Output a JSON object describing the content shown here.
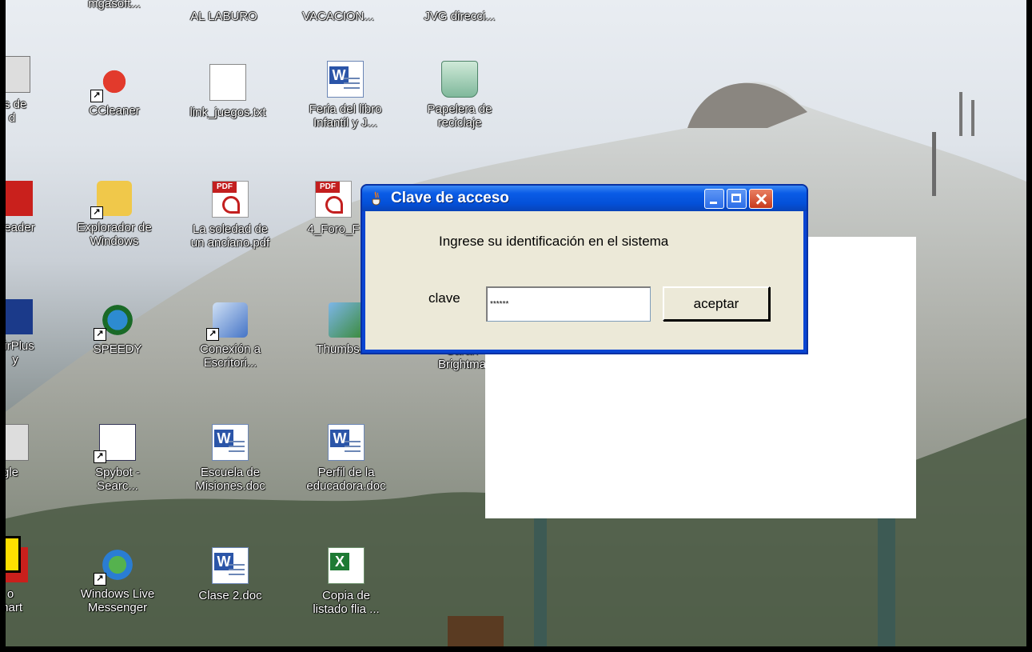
{
  "desktop": {
    "icons": [
      {
        "name": "icon-partial-top-1",
        "label": "mgasoft...",
        "type": "generic"
      },
      {
        "name": "icon-al-laburo",
        "label": "AL LABURO",
        "type": "generic"
      },
      {
        "name": "icon-vacacion",
        "label": "VACACION...",
        "type": "generic"
      },
      {
        "name": "icon-jvg-direcci",
        "label": "JVG direcci...",
        "type": "generic"
      },
      {
        "name": "icon-favoritos-de-red",
        "label": "os de\nd",
        "type": "generic"
      },
      {
        "name": "icon-ccleaner",
        "label": "CCleaner",
        "type": "ccleaner"
      },
      {
        "name": "icon-link-juegos",
        "label": "link_juegos.txt",
        "type": "txt"
      },
      {
        "name": "icon-feria-del-libro",
        "label": "Feria del libro\nInfantil y J...",
        "type": "word"
      },
      {
        "name": "icon-papelera",
        "label": "Papelera de\nreciclaje",
        "type": "bin"
      },
      {
        "name": "icon-adobe-reader",
        "label": "Reader",
        "type": "redicon"
      },
      {
        "name": "icon-explorador-windows",
        "label": "Explorador de\nWindows",
        "type": "explorer"
      },
      {
        "name": "icon-la-soledad",
        "label": "La soledad de\nun anciano.pdf",
        "type": "pdf"
      },
      {
        "name": "icon-4-foro",
        "label": "4_Foro_F",
        "type": "pdf"
      },
      {
        "name": "icon-airplus",
        "label": "AirPlus\ny",
        "type": "blueicon"
      },
      {
        "name": "icon-speedy",
        "label": "SPEEDY",
        "type": "speedy"
      },
      {
        "name": "icon-conexion-escritorio",
        "label": "Conexión a\nEscritori...",
        "type": "remote"
      },
      {
        "name": "icon-thumbs-db",
        "label": "Thumbs.db",
        "type": "thumbs"
      },
      {
        "name": "icon-sarah-brightman",
        "label": "Sarah\nBrightma",
        "type": "generic"
      },
      {
        "name": "icon-google",
        "label": "gle",
        "type": "generic"
      },
      {
        "name": "icon-spybot",
        "label": "Spybot -\nSearc...",
        "type": "spybot"
      },
      {
        "name": "icon-escuela-misiones",
        "label": "Escuela de\nMisiones.doc",
        "type": "word"
      },
      {
        "name": "icon-perfil-educadora",
        "label": "Perfil de la\neducadora.doc",
        "type": "word"
      },
      {
        "name": "icon-smart",
        "label": "o\nmart",
        "type": "redicon"
      },
      {
        "name": "icon-windows-live-messenger",
        "label": "Windows Live\nMessenger",
        "type": "messenger"
      },
      {
        "name": "icon-clase-2",
        "label": "Clase 2.doc",
        "type": "word"
      },
      {
        "name": "icon-copia-listado",
        "label": "Copia de\nlistado flia ...",
        "type": "excel"
      }
    ]
  },
  "dialog": {
    "title": "Clave de acceso",
    "prompt": "Ingrese su identificación en el sistema",
    "password_label": "clave",
    "password_value": "******",
    "accept_label": "aceptar"
  },
  "colors": {
    "titlebar": "#0a5ce6",
    "client": "#ece9d8",
    "close_button": "#c7391c"
  }
}
